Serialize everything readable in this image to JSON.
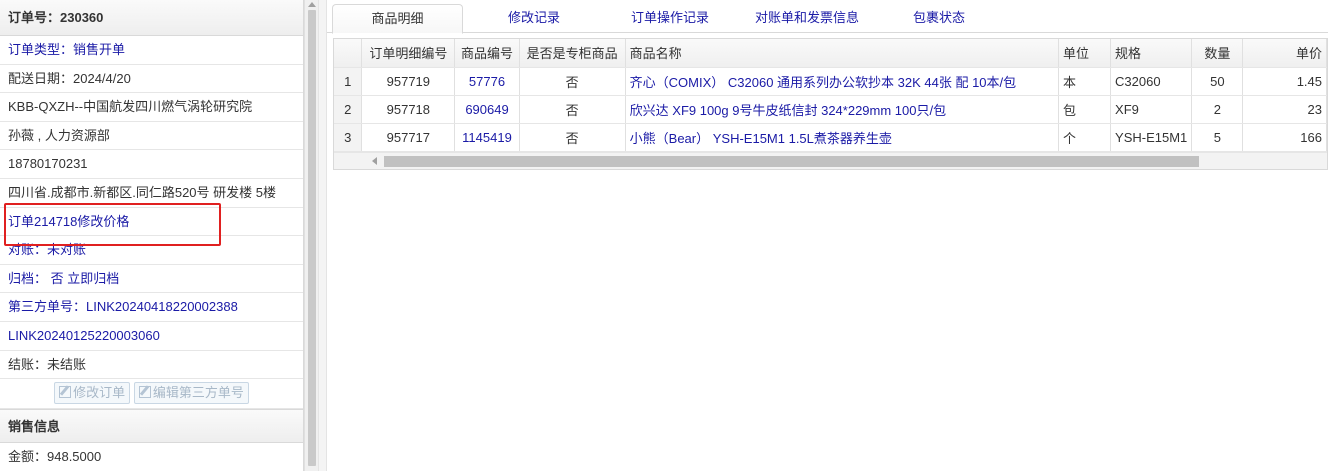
{
  "order": {
    "title": "订单号：230360",
    "rows": [
      {
        "text": "订单类型：销售开单",
        "color": "blue"
      },
      {
        "text": "配送日期：2024/4/20",
        "color": "normal"
      },
      {
        "text": "KBB-QXZH--中国航发四川燃气涡轮研究院",
        "color": "normal"
      },
      {
        "text": "孙薇 , 人力资源部",
        "color": "normal"
      },
      {
        "text": "18780170231",
        "color": "normal"
      },
      {
        "text": "四川省.成都市.新都区.同仁路520号 研发楼 5楼",
        "color": "normal"
      },
      {
        "text": "订单214718修改价格",
        "color": "blue"
      },
      {
        "text": "对账：未对账",
        "color": "blue"
      },
      {
        "text": "归档： 否 立即归档",
        "color": "blue"
      },
      {
        "text": "第三方单号：LINK20240418220002388",
        "color": "blue"
      },
      {
        "text": "LINK20240125220003060",
        "color": "blue"
      },
      {
        "text": "结账：未结账",
        "color": "normal"
      }
    ],
    "buttons": {
      "edit_order": "修改订单",
      "edit_third": "编辑第三方单号"
    },
    "sales_section": "销售信息",
    "amount": "金额：948.5000"
  },
  "tabs": [
    "商品明细",
    "修改记录",
    "订单操作记录",
    "对账单和发票信息",
    "包裹状态"
  ],
  "table": {
    "headers": [
      "",
      "订单明细编号",
      "商品编号",
      "是否是专柜商品",
      "商品名称",
      "单位",
      "规格",
      "数量",
      "单价"
    ],
    "rows": [
      {
        "idx": "1",
        "detail_id": "957719",
        "product_id": "57776",
        "counter": "否",
        "name": "齐心（COMIX） C32060 通用系列办公软抄本 32K 44张 配 10本/包",
        "unit": "本",
        "spec": "C32060",
        "qty": "50",
        "price": "1.45"
      },
      {
        "idx": "2",
        "detail_id": "957718",
        "product_id": "690649",
        "counter": "否",
        "name": "欣兴达 XF9 100g 9号牛皮纸信封 324*229mm 100只/包",
        "unit": "包",
        "spec": "XF9",
        "qty": "2",
        "price": "23"
      },
      {
        "idx": "3",
        "detail_id": "957717",
        "product_id": "1145419",
        "counter": "否",
        "name": "小熊（Bear） YSH-E15M1 1.5L煮茶器养生壶",
        "unit": "个",
        "spec": "YSH-E15M1",
        "qty": "5",
        "price": "166"
      }
    ]
  },
  "colors": {
    "link": "#1a1aa6",
    "highlight": "#e02020"
  }
}
